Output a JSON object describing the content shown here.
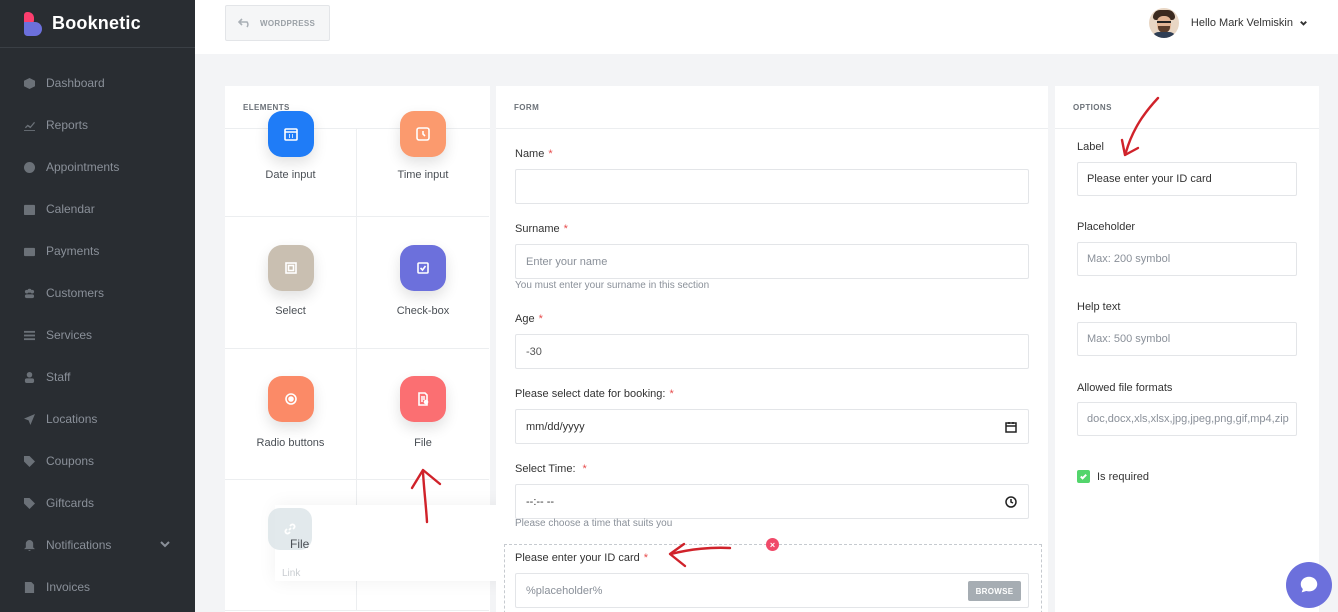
{
  "app": {
    "name": "Booknetic"
  },
  "sidebar": {
    "items": [
      {
        "label": "Dashboard",
        "icon": "cube-icon"
      },
      {
        "label": "Reports",
        "icon": "chart-icon"
      },
      {
        "label": "Appointments",
        "icon": "clock-icon"
      },
      {
        "label": "Calendar",
        "icon": "calendar-icon"
      },
      {
        "label": "Payments",
        "icon": "wallet-icon"
      },
      {
        "label": "Customers",
        "icon": "users-icon"
      },
      {
        "label": "Services",
        "icon": "list-icon"
      },
      {
        "label": "Staff",
        "icon": "user-icon"
      },
      {
        "label": "Locations",
        "icon": "location-arrow-icon"
      },
      {
        "label": "Coupons",
        "icon": "tag-icon"
      },
      {
        "label": "Giftcards",
        "icon": "gift-icon"
      },
      {
        "label": "Notifications",
        "icon": "bell-icon"
      },
      {
        "label": "Invoices",
        "icon": "file-icon"
      }
    ]
  },
  "topbar": {
    "back_label": "WORDPRESS",
    "user_greeting": "Hello Mark Velmiskin"
  },
  "elements_panel": {
    "title": "ELEMENTS",
    "items": [
      {
        "label": "Date input",
        "color": "#1f7cf7",
        "icon": "calendar-icon"
      },
      {
        "label": "Time input",
        "color": "#fb9a6e",
        "icon": "clock-icon"
      },
      {
        "label": "Select",
        "color": "#c9bfb1",
        "icon": "select-icon"
      },
      {
        "label": "Check-box",
        "color": "#6c70dc",
        "icon": "checkbox-icon"
      },
      {
        "label": "Radio buttons",
        "color": "#fb8a67",
        "icon": "radio-icon"
      },
      {
        "label": "File",
        "color": "#fb6f72",
        "icon": "file-icon"
      }
    ],
    "dragging": {
      "label": "File",
      "sublabel": "Link"
    }
  },
  "form_panel": {
    "title": "FORM",
    "fields": [
      {
        "label": "Name",
        "value": "",
        "help": ""
      },
      {
        "label": "Surname",
        "placeholder": "Enter your name",
        "help": "You must enter your surname in this section"
      },
      {
        "label": "Age",
        "value": "-30"
      },
      {
        "label": "Please select date for booking:",
        "value": "mm/dd/yyyy"
      },
      {
        "label": "Select Time:",
        "value": "--:-- --",
        "help": "Please choose a time that suits you"
      },
      {
        "label": "Please enter your ID card",
        "placeholder": "%placeholder%",
        "button": "BROWSE"
      }
    ]
  },
  "options_panel": {
    "title": "OPTIONS",
    "label": {
      "label": "Label",
      "value": "Please enter your ID card"
    },
    "placeholder": {
      "label": "Placeholder",
      "value": "Max: 200 symbol"
    },
    "help_text": {
      "label": "Help text",
      "value": "Max: 500 symbol"
    },
    "allowed_formats": {
      "label": "Allowed file formats",
      "value": "doc,docx,xls,xlsx,jpg,jpeg,png,gif,mp4,zip"
    },
    "required": {
      "label": "Is required",
      "checked": true
    }
  },
  "colors": {
    "accent": "#6c70dc",
    "sidebar_bg": "#292d32",
    "required": "#e74c4c",
    "annotation": "#d0222a"
  }
}
